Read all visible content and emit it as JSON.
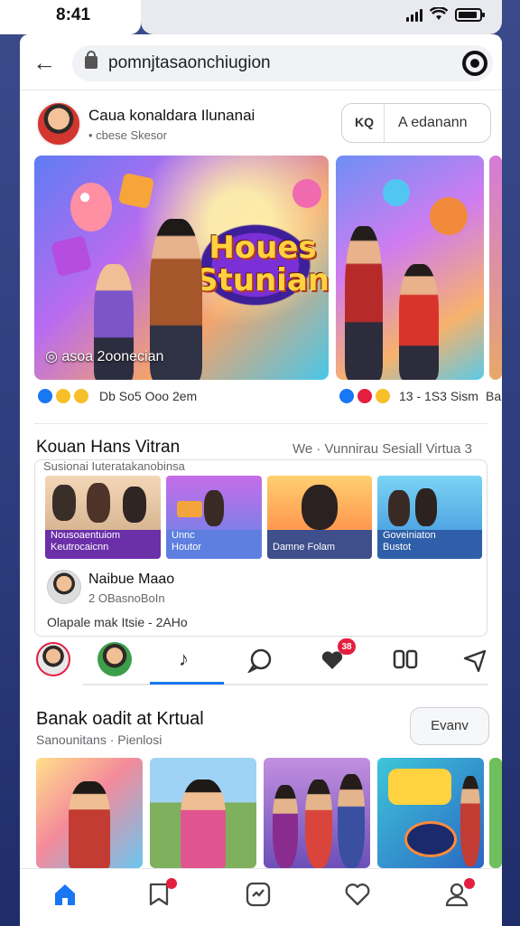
{
  "status": {
    "time": "8:41"
  },
  "browser": {
    "url": "pomnjtasaonchiugion"
  },
  "post": {
    "page_name": "Caua konaldara Ilunanai",
    "page_sub": "• cbese Skesor",
    "follow_icon": "KQ",
    "follow_label": "A edanann",
    "main_logo": "Houes Stunian",
    "main_caption": "◎ asoa 2oonecian",
    "main_reactions": "Db So5 Ooo 2em",
    "side_reactions": "13 - 1S3 Sism",
    "edge_reactions": "Ba"
  },
  "stories": {
    "title": "Kouan Hans Vitran",
    "link": "We · Vunnirau Sesiall Virtua 3",
    "subtitle": "Susionai Iuteratakanobinsa",
    "tiles": [
      {
        "label": "Nousoaentuiom\nKeutrocaicnn"
      },
      {
        "label": "Unnc\nHoutor"
      },
      {
        "label": "Damne Folam"
      },
      {
        "label": "Goveiniaton\nBustot"
      }
    ],
    "author_name": "Naibue Maao",
    "author_meta": "2 OBasnoBoIn",
    "comment": "Olapale mak Itsie - 2AHo"
  },
  "icon_tabs": {
    "badge_count": "38"
  },
  "section": {
    "title": "Banak oadit at Krtual",
    "subtitle": "Sanounitans · Pienlosi",
    "button": "Evanv"
  },
  "colors": {
    "accent": "#1877f2",
    "badge": "#e41e3f"
  }
}
